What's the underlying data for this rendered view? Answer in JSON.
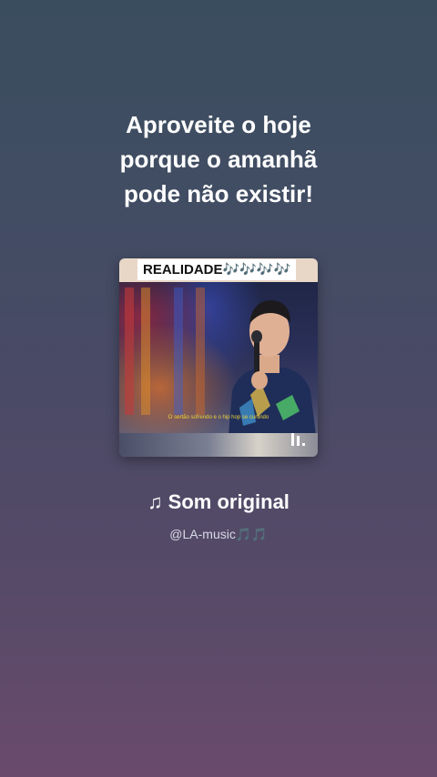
{
  "quote": {
    "lines": [
      "Aproveite o hoje",
      "porque o amanhã",
      "pode não existir!"
    ]
  },
  "thumbnail": {
    "tag": "REALIDADE🎶🎶🎶🎶",
    "caption": "O sertão sofrendo e o hip hop se curtindo"
  },
  "sound": {
    "title": "♫ Som original",
    "author": "@LA-music",
    "author_suffix": "🎵🎵"
  },
  "colors": {
    "background_top": "#3a4d5e",
    "background_bottom": "#6a4a6c",
    "text_primary": "#ffffff",
    "accent_purple": "#a052e6"
  },
  "icons": {
    "thumbnail_corner": "pause-bars-icon"
  }
}
